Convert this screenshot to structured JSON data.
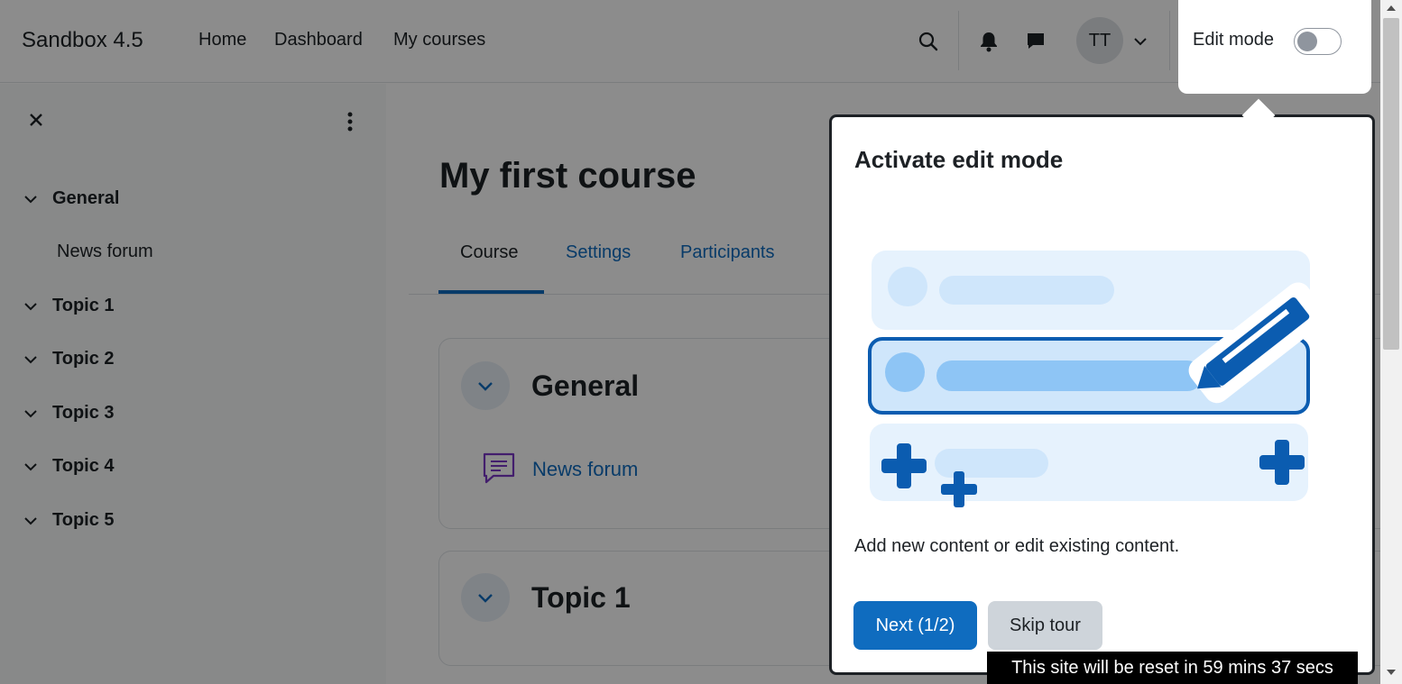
{
  "navbar": {
    "brand": "Sandbox 4.5",
    "links": [
      "Home",
      "Dashboard",
      "My courses"
    ],
    "user_initials": "TT",
    "edit_mode_label": "Edit mode"
  },
  "drawer": {
    "items": [
      {
        "label": "General",
        "children": [
          "News forum"
        ]
      },
      {
        "label": "Topic 1"
      },
      {
        "label": "Topic 2"
      },
      {
        "label": "Topic 3"
      },
      {
        "label": "Topic 4"
      },
      {
        "label": "Topic 5"
      }
    ]
  },
  "course": {
    "title": "My first course",
    "tabs": [
      "Course",
      "Settings",
      "Participants"
    ],
    "sections": [
      {
        "title": "General",
        "activities": [
          "News forum"
        ]
      },
      {
        "title": "Topic 1"
      }
    ]
  },
  "tour": {
    "title": "Activate edit mode",
    "body": "Add new content or edit existing content.",
    "next_label": "Next (1/2)",
    "skip_label": "Skip tour"
  },
  "reset_notice": "This site will be reset in 59 mins 37 secs",
  "colors": {
    "primary": "#0f6cbf",
    "text": "#1d2125",
    "drawer_bg": "#f8f9fa",
    "skip_bg": "#ced4da"
  }
}
